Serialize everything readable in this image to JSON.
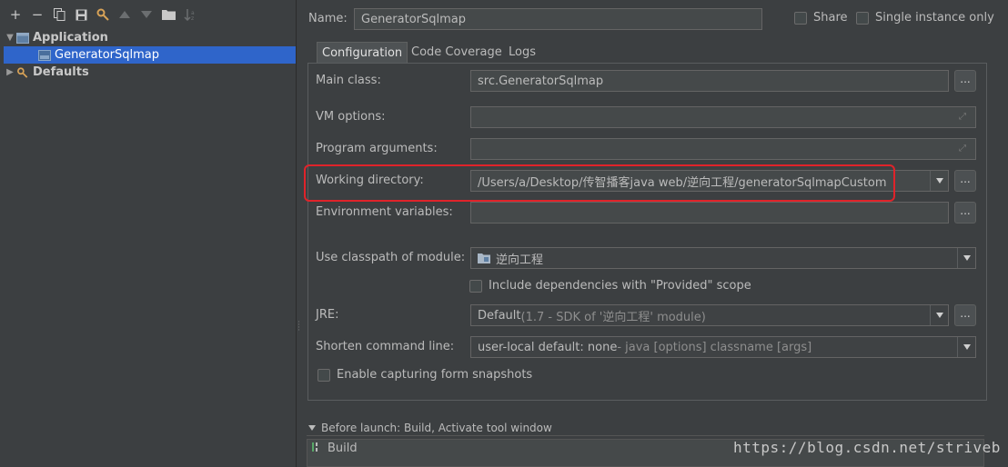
{
  "toolbar": {
    "icons": [
      "add-icon",
      "remove-icon",
      "copy-icon",
      "save-icon",
      "wrench-icon",
      "move-up-icon",
      "move-down-icon",
      "folder-icon",
      "sort-icon"
    ],
    "add": "+",
    "remove": "−"
  },
  "tree": {
    "application": {
      "label": "Application",
      "expanded": true,
      "children": [
        {
          "label": "GeneratorSqlmap",
          "selected": true
        }
      ]
    },
    "defaults": {
      "label": "Defaults",
      "expanded": false
    }
  },
  "header": {
    "name_label": "Name:",
    "name_value": "GeneratorSqlmap",
    "share_label": "Share",
    "single_instance_label": "Single instance only"
  },
  "tabs": [
    {
      "label": "Configuration",
      "active": true
    },
    {
      "label": "Code Coverage",
      "active": false
    },
    {
      "label": "Logs",
      "active": false
    }
  ],
  "config": {
    "main_class": {
      "label": "Main class:",
      "value": "src.GeneratorSqlmap",
      "button": "..."
    },
    "vm_options": {
      "label": "VM options:",
      "value": ""
    },
    "program_arguments": {
      "label": "Program arguments:",
      "value": ""
    },
    "working_directory": {
      "label": "Working directory:",
      "value": "/Users/a/Desktop/传智播客java web/逆向工程/generatorSqlmapCustom",
      "button": "..."
    },
    "environment_variables": {
      "label": "Environment variables:",
      "value": "",
      "button": "..."
    },
    "classpath_module": {
      "label": "Use classpath of module:",
      "value": "逆向工程"
    },
    "include_dependencies": {
      "label": "Include dependencies with \"Provided\" scope",
      "checked": false
    },
    "jre": {
      "label": "JRE:",
      "value_main": "Default",
      "value_detail": " (1.7 - SDK of '逆向工程' module)",
      "button": "..."
    },
    "shorten_command_line": {
      "label": "Shorten command line:",
      "value_main": "user-local default: none",
      "value_detail": " - java [options] classname [args]"
    },
    "enable_snapshots": {
      "label": "Enable capturing form snapshots",
      "checked": false
    }
  },
  "before_launch": {
    "label": "Before launch: Build, Activate tool window",
    "items": [
      {
        "label": "Build"
      }
    ]
  },
  "watermark": "https://blog.csdn.net/striveb",
  "colors": {
    "background": "#3c3f41",
    "selection": "#2f65ca",
    "field": "#45494a",
    "highlight_box": "#e0232a"
  }
}
